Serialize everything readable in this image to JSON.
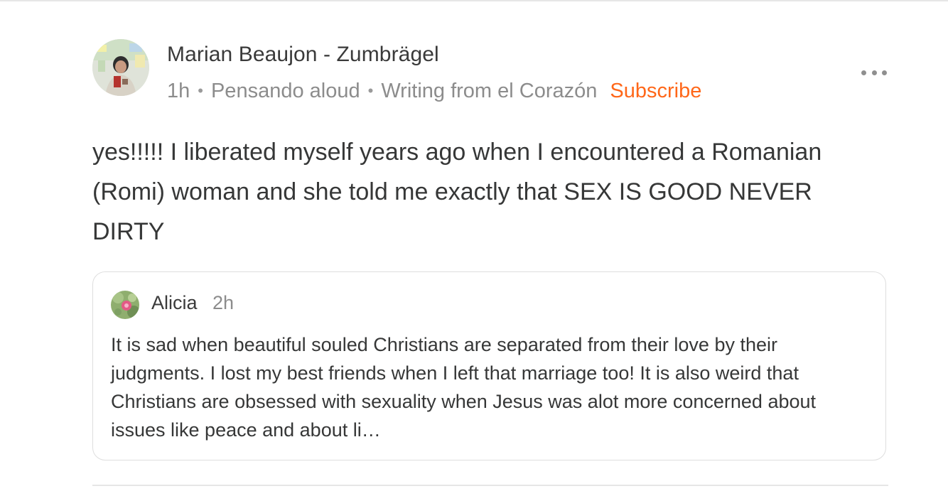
{
  "comment": {
    "author": "Marian Beaujon - Zumbrägel",
    "time": "1h",
    "publication": "Pensando aloud",
    "section": "Writing from el Corazón",
    "subscribe_label": "Subscribe",
    "body": "yes!!!!! I liberated myself years ago when I encountered a Romanian (Romi) woman and she told me exactly that SEX IS GOOD NEVER DIRTY",
    "separator": "•",
    "more_icon": "more-horizontal-icon"
  },
  "quoted_comment": {
    "author": "Alicia",
    "time": "2h",
    "text": "It is sad when beautiful souled Christians are separated from their love by their judgments. I lost my best friends when I left that marriage too! It is also weird that Christians are obsessed with sexuality when Jesus was alot more concerned about issues like peace and about li…"
  },
  "colors": {
    "accent": "#ff6719",
    "text_primary": "#363737",
    "text_secondary": "#8c8c8c",
    "border": "#dedede"
  }
}
